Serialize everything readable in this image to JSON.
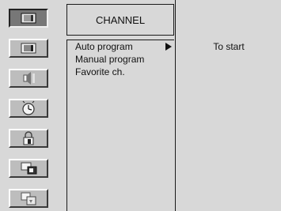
{
  "menu": {
    "title": "CHANNEL",
    "items": [
      {
        "label": "Auto program",
        "selected": true
      },
      {
        "label": "Manual program",
        "selected": false
      },
      {
        "label": "Favorite ch.",
        "selected": false
      }
    ]
  },
  "submenu": {
    "action_label": "To start"
  },
  "sidebar": {
    "icons": [
      "picture-icon",
      "screen-icon",
      "sound-icon",
      "timer-icon",
      "lock-icon",
      "pip-icon",
      "special-icon"
    ],
    "active_index": 0
  },
  "colors": {
    "background": "#d8d8d8",
    "active_button": "#777777",
    "button": "#bdbdbd",
    "border": "#1a1a1a"
  }
}
